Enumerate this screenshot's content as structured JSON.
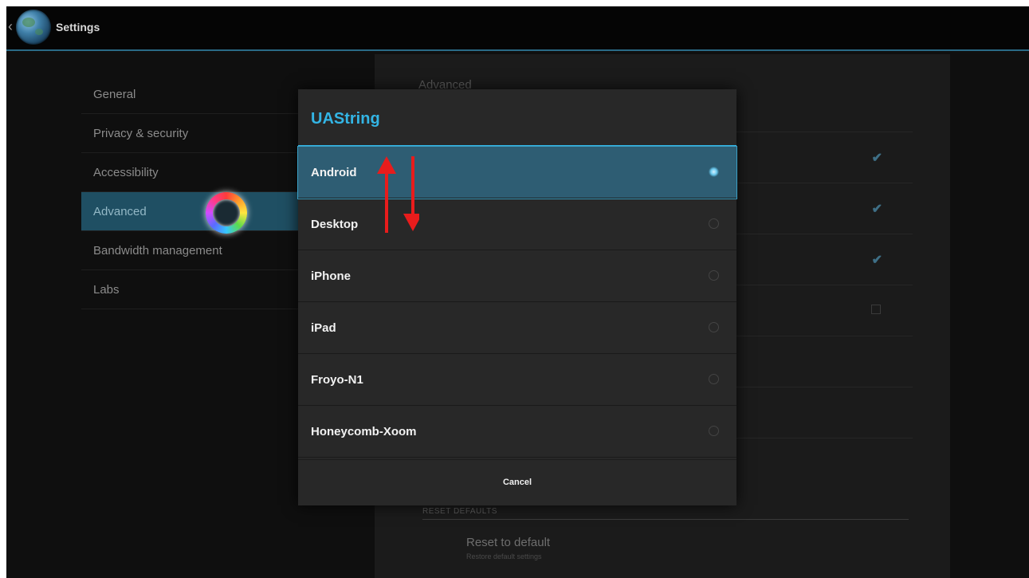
{
  "action_bar": {
    "title": "Settings"
  },
  "categories": [
    {
      "label": "General"
    },
    {
      "label": "Privacy & security"
    },
    {
      "label": "Accessibility"
    },
    {
      "label": "Advanced",
      "selected": true
    },
    {
      "label": "Bandwidth management"
    },
    {
      "label": "Labs"
    }
  ],
  "detail": {
    "title": "Advanced",
    "checkbox_states": [
      true,
      true,
      true,
      false
    ],
    "reset_section_header": "RESET DEFAULTS",
    "reset_title": "Reset to default",
    "reset_subtitle": "Restore default settings"
  },
  "dialog": {
    "title": "UAString",
    "options": [
      {
        "label": "Android",
        "selected": true
      },
      {
        "label": "Desktop",
        "selected": false
      },
      {
        "label": "iPhone",
        "selected": false
      },
      {
        "label": "iPad",
        "selected": false
      },
      {
        "label": "Froyo-N1",
        "selected": false
      },
      {
        "label": "Honeycomb-Xoom",
        "selected": false
      }
    ],
    "cancel_label": "Cancel"
  },
  "colors": {
    "accent": "#33b5e5",
    "selection": "#2e5d73",
    "category_selected": "#1f4f63",
    "annotation_arrow": "#e81c1c"
  }
}
